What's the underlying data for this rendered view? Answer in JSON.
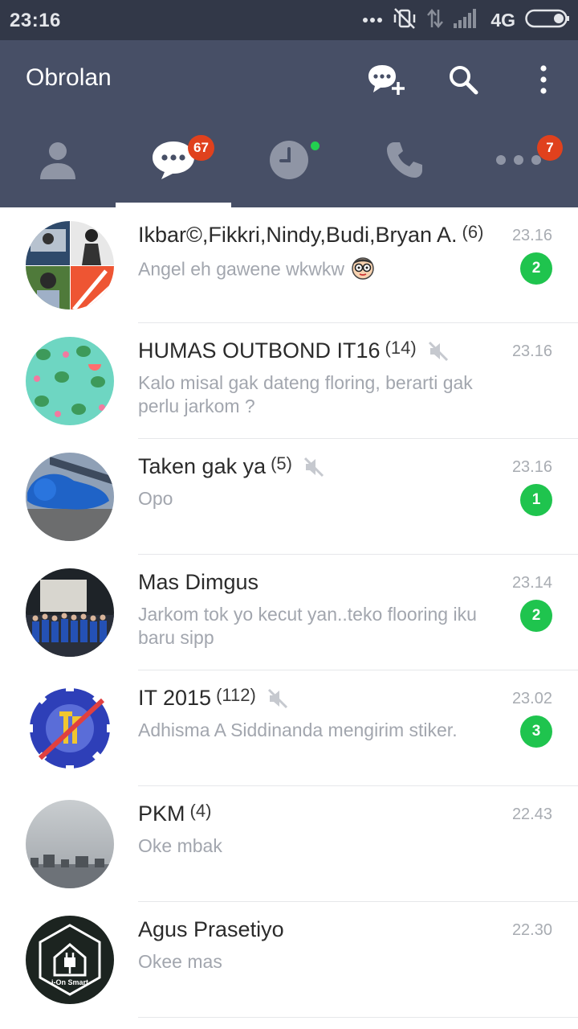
{
  "status_bar": {
    "time": "23:16",
    "network": "4G"
  },
  "header": {
    "title": "Obrolan"
  },
  "tabs": {
    "chats_badge": "67",
    "more_badge": "7"
  },
  "chats": [
    {
      "name": "Ikbar©,Fikkri,Nindy,Budi,Bryan A.",
      "count": "(6)",
      "message": "Angel eh gawene wkwkw",
      "time": "23.16",
      "unread": "2",
      "muted": false
    },
    {
      "name": "HUMAS OUTBOND IT16",
      "count": "(14)",
      "message": "Kalo misal gak dateng floring, berarti gak perlu jarkom ?",
      "time": "23.16",
      "unread": "",
      "muted": true
    },
    {
      "name": "Taken gak ya",
      "count": "(5)",
      "message": "Opo",
      "time": "23.16",
      "unread": "1",
      "muted": true
    },
    {
      "name": "Mas Dimgus",
      "count": "",
      "message": "Jarkom tok yo kecut yan..teko flooring iku baru sipp",
      "time": "23.14",
      "unread": "2",
      "muted": false
    },
    {
      "name": "IT 2015",
      "count": "(112)",
      "message": "Adhisma A Siddinanda mengirim stiker.",
      "time": "23.02",
      "unread": "3",
      "muted": true
    },
    {
      "name": "PKM",
      "count": "(4)",
      "message": "Oke mbak",
      "time": "22.43",
      "unread": "",
      "muted": false
    },
    {
      "name": "Agus Prasetiyo",
      "count": "",
      "message": "Okee mas",
      "time": "22.30",
      "unread": "",
      "muted": false
    }
  ],
  "avatar_logo_text": "i-On Smart",
  "colors": {
    "header": "#474f66",
    "status_bar": "#323848",
    "badge": "#e0411d",
    "unread": "#1fc44e"
  }
}
